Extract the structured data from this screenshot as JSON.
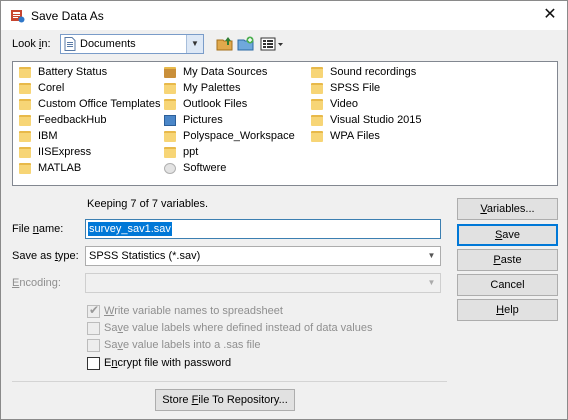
{
  "window": {
    "title": "Save Data As",
    "close_glyph": "✕"
  },
  "lookin": {
    "label_pre": "Look ",
    "label_key": "i",
    "label_post": "n:",
    "value": "Documents",
    "icons": [
      "up-folder-icon",
      "new-folder-icon",
      "view-menu-icon"
    ]
  },
  "files": [
    {
      "label": "Battery Status",
      "icon": "folder-icon"
    },
    {
      "label": "Corel",
      "icon": "folder-icon"
    },
    {
      "label": "Custom Office Templates",
      "icon": "folder-icon"
    },
    {
      "label": "FeedbackHub",
      "icon": "folder-icon"
    },
    {
      "label": "IBM",
      "icon": "folder-icon"
    },
    {
      "label": "IISExpress",
      "icon": "folder-icon"
    },
    {
      "label": "MATLAB",
      "icon": "folder-icon"
    },
    {
      "label": "My Data Sources",
      "icon": "data-sources-folder-icon"
    },
    {
      "label": "My Palettes",
      "icon": "folder-icon"
    },
    {
      "label": "Outlook Files",
      "icon": "folder-icon"
    },
    {
      "label": "Pictures",
      "icon": "pictures-folder-icon"
    },
    {
      "label": "Polyspace_Workspace",
      "icon": "folder-icon"
    },
    {
      "label": "ppt",
      "icon": "folder-icon"
    },
    {
      "label": "Softwere",
      "icon": "software-folder-icon"
    },
    {
      "label": "Sound recordings",
      "icon": "folder-icon"
    },
    {
      "label": "SPSS File",
      "icon": "folder-icon"
    },
    {
      "label": "Video",
      "icon": "folder-icon"
    },
    {
      "label": "Visual Studio 2015",
      "icon": "folder-icon"
    },
    {
      "label": "WPA Files",
      "icon": "folder-icon"
    }
  ],
  "keeping_text": "Keeping 7 of 7 variables.",
  "filename": {
    "label_pre": "File ",
    "label_key": "n",
    "label_post": "ame:",
    "value": "survey_sav1.sav"
  },
  "saveas": {
    "label_pre": "Save as ",
    "label_key": "t",
    "label_post": "ype:",
    "value": "SPSS Statistics (*.sav)"
  },
  "encoding": {
    "label_key": "E",
    "label_post": "ncoding:",
    "value": ""
  },
  "checkboxes": [
    {
      "pre": "",
      "key": "W",
      "post": "rite variable names to spreadsheet",
      "checked": true,
      "disabled": true
    },
    {
      "pre": "Sa",
      "key": "v",
      "post": "e value labels where defined instead of data values",
      "checked": false,
      "disabled": true
    },
    {
      "pre": "Sa",
      "key": "v",
      "post": "e value labels into a .sas file",
      "checked": false,
      "disabled": true
    },
    {
      "pre": "E",
      "key": "n",
      "post": "crypt file with password",
      "checked": false,
      "disabled": false
    }
  ],
  "buttons": {
    "variables": {
      "key": "V",
      "post": "ariables..."
    },
    "save": {
      "key": "S",
      "post": "ave"
    },
    "paste": {
      "key": "P",
      "post": "aste"
    },
    "cancel": "Cancel",
    "help": {
      "key": "H",
      "post": "elp"
    },
    "store": {
      "pre": "Store ",
      "key": "F",
      "post": "ile To Repository..."
    }
  },
  "colors": {
    "selection": "#0078d7",
    "folder": "#f7d576",
    "default_button_border": "#0078d7"
  }
}
